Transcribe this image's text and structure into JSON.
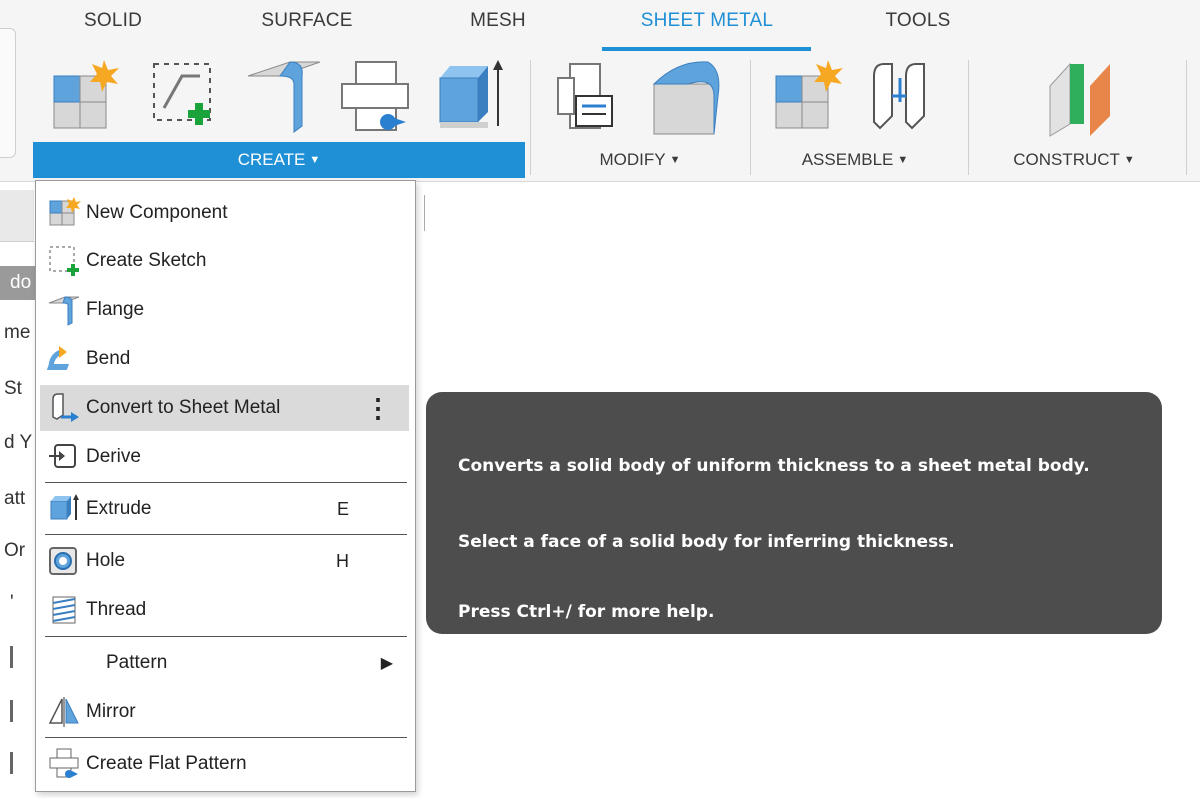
{
  "ribbon": {
    "tabs": [
      {
        "label": "SOLID",
        "active": false
      },
      {
        "label": "SURFACE",
        "active": false
      },
      {
        "label": "MESH",
        "active": false
      },
      {
        "label": "SHEET METAL",
        "active": true
      },
      {
        "label": "TOOLS",
        "active": false
      }
    ],
    "groups": [
      {
        "label": "CREATE",
        "active": true
      },
      {
        "label": "MODIFY",
        "active": false
      },
      {
        "label": "ASSEMBLE",
        "active": false
      },
      {
        "label": "CONSTRUCT",
        "active": false
      }
    ],
    "caret": "▼",
    "tools": [
      {
        "icon": "new-component-icon"
      },
      {
        "icon": "create-sketch-icon"
      },
      {
        "icon": "flange-icon"
      },
      {
        "icon": "create-flat-pattern-icon"
      },
      {
        "icon": "extrude-icon"
      },
      {
        "icon": "unfold-icon"
      },
      {
        "icon": "bend-corner-icon"
      },
      {
        "icon": "assemble-new-component-icon"
      },
      {
        "icon": "joint-icon"
      },
      {
        "icon": "construct-plane-icon"
      }
    ]
  },
  "menu": {
    "items": [
      {
        "label": "New Component",
        "icon": "new-component-icon",
        "shortcut": ""
      },
      {
        "label": "Create Sketch",
        "icon": "create-sketch-icon",
        "shortcut": ""
      },
      {
        "label": "Flange",
        "icon": "flange-icon",
        "shortcut": ""
      },
      {
        "label": "Bend",
        "icon": "bend-icon",
        "shortcut": ""
      },
      {
        "label": "Convert to Sheet Metal",
        "icon": "convert-to-sheet-metal-icon",
        "shortcut": "",
        "highlighted": true,
        "more": "⋮"
      },
      {
        "label": "Derive",
        "icon": "derive-icon",
        "shortcut": ""
      },
      {
        "label": "Extrude",
        "icon": "extrude-icon",
        "shortcut": "E"
      },
      {
        "label": "Hole",
        "icon": "hole-icon",
        "shortcut": "H"
      },
      {
        "label": "Thread",
        "icon": "thread-icon",
        "shortcut": ""
      },
      {
        "label": "Pattern",
        "icon": "",
        "shortcut": "",
        "submenu": "▶"
      },
      {
        "label": "Mirror",
        "icon": "mirror-icon",
        "shortcut": ""
      },
      {
        "label": "Create Flat Pattern",
        "icon": "create-flat-pattern-icon",
        "shortcut": ""
      }
    ]
  },
  "tooltip": {
    "description": "Converts a solid body of uniform thickness to a sheet metal body.",
    "instruction": "Select a face of a solid body for inferring thickness.",
    "help": "Press Ctrl+/ for more help."
  },
  "browser_partial": {
    "rows": [
      "do",
      "me",
      "St",
      "d Y",
      "att",
      "Or",
      "'"
    ]
  },
  "colors": {
    "accent": "#1f8fd6",
    "tooltip_bg": "#4d4d4d",
    "menu_highlight": "#dadada"
  }
}
